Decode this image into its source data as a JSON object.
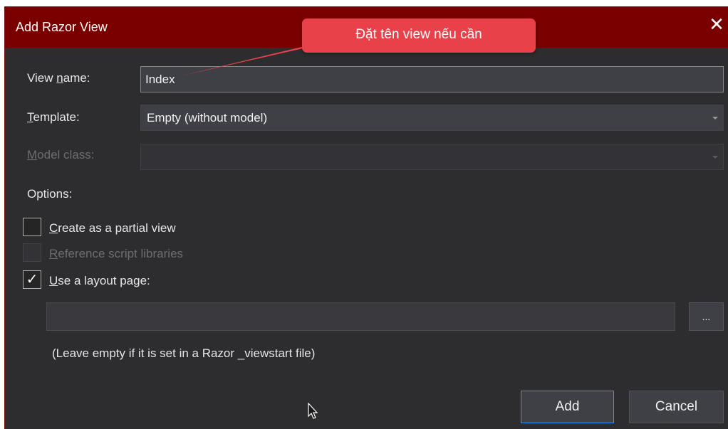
{
  "dialog": {
    "title": "Add Razor View",
    "close_glyph": "✕"
  },
  "fields": {
    "view_name": {
      "label_prefix": "View ",
      "label_mnemonic": "n",
      "label_suffix": "ame:",
      "value": "Index"
    },
    "template": {
      "label_mnemonic": "T",
      "label_suffix": "emplate:",
      "value": "Empty (without model)"
    },
    "model_class": {
      "label_mnemonic": "M",
      "label_suffix": "odel class:",
      "value": ""
    }
  },
  "options": {
    "heading": "Options:",
    "partial_view": {
      "mnemonic": "C",
      "rest": "reate as a partial view",
      "checked": false
    },
    "script_libraries": {
      "mnemonic": "R",
      "rest": "eference script libraries",
      "checked": false
    },
    "layout_page": {
      "mnemonic": "U",
      "rest": "se a layout page:",
      "checked": true,
      "check_glyph": "✓"
    },
    "layout_path_value": "",
    "browse_label": "...",
    "hint": "(Leave empty if it is set in a Razor _viewstart file)"
  },
  "buttons": {
    "add": "Add",
    "cancel": "Cancel"
  },
  "callout": {
    "text": "Đặt tên view nếu cần"
  },
  "colors": {
    "titlebar": "#7a0000",
    "dialog_bg": "#2d2d30",
    "focus_border": "#3399ff",
    "callout": "#e8414a"
  }
}
